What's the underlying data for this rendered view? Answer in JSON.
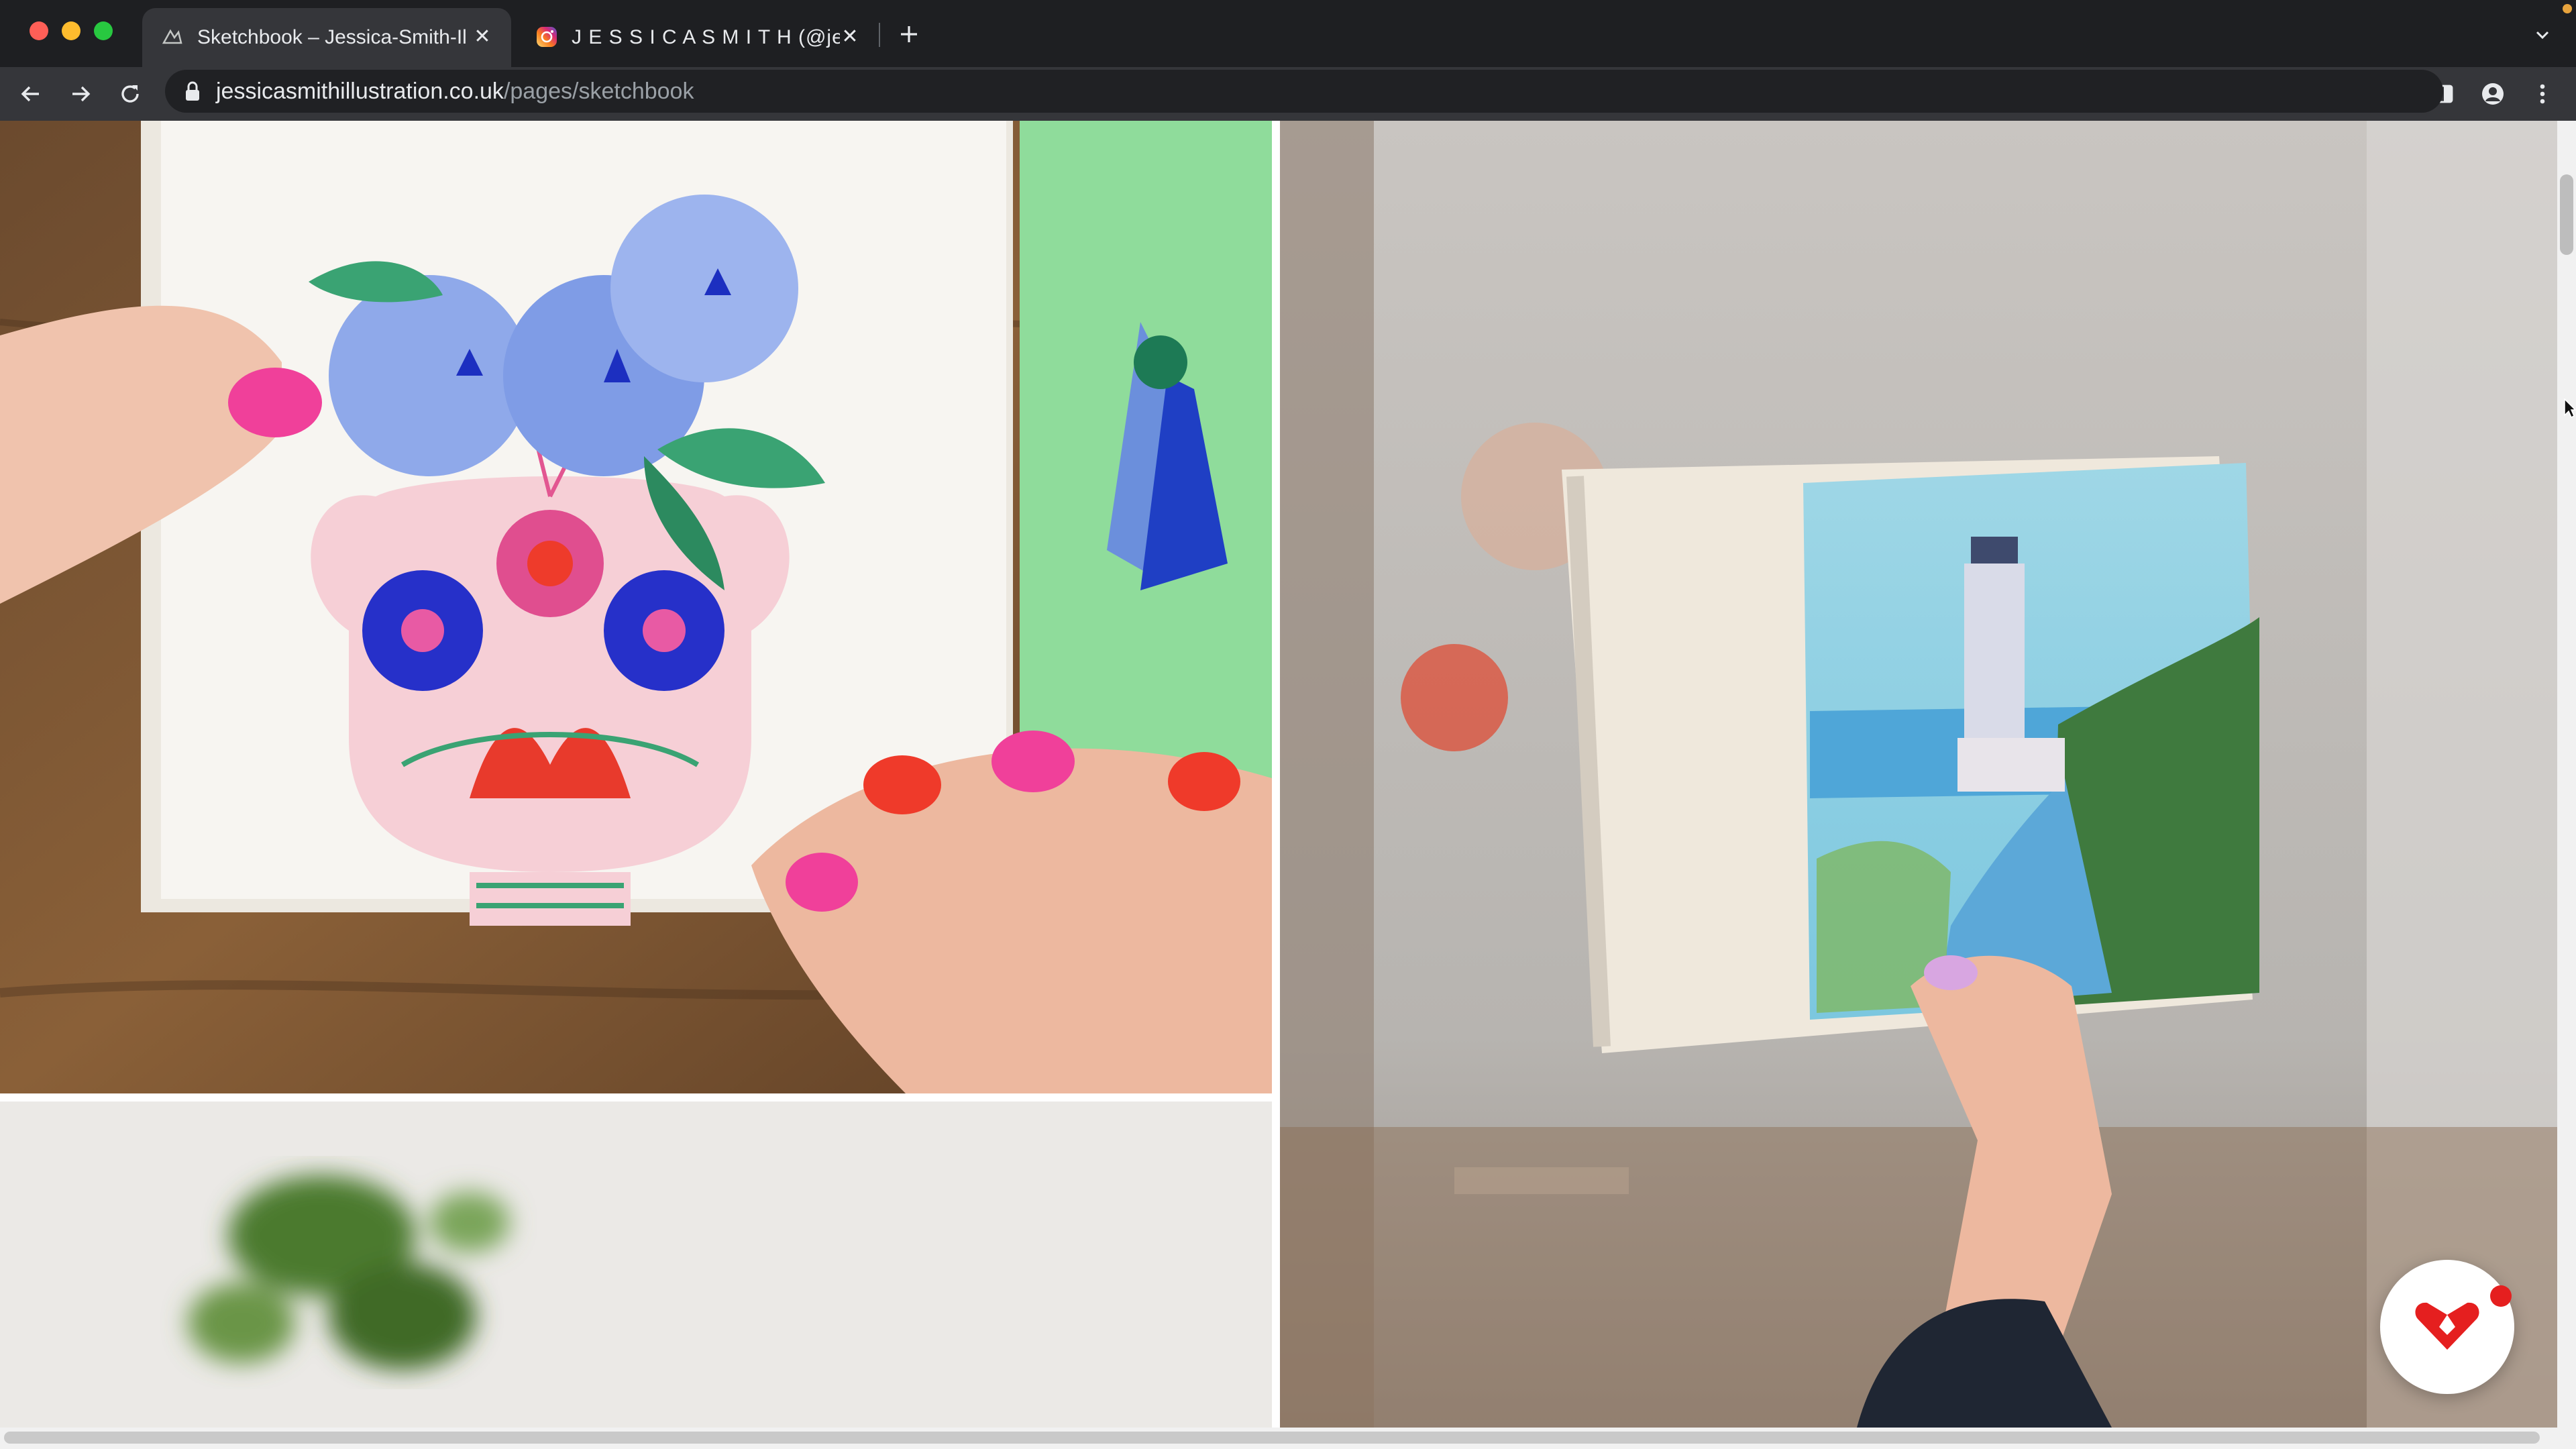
{
  "browser": {
    "tabs": [
      {
        "title": "Sketchbook – Jessica-Smith-Il",
        "favicon": "site-favicon",
        "active": true
      },
      {
        "title": "J E S S I C A S M I T H (@jessic",
        "favicon": "instagram-icon",
        "active": false
      }
    ],
    "url_domain": "jessicasmithillustration.co.uk",
    "url_path": "/pages/sketchbook",
    "colors": {
      "frame": "#1e1f22",
      "toolbar": "#35363a",
      "omnibox": "#202124"
    }
  },
  "page": {
    "photos": [
      {
        "subject": "hands holding sketchbook with painted vase and blue flowers"
      },
      {
        "subject": "hand holding open sketchbook with coloured-pencil lighthouse drawing"
      },
      {
        "subject": "blurred green plant on white background"
      }
    ],
    "chat_widget": {
      "icon": "heart-chat-icon",
      "accent": "#e51f1f"
    }
  }
}
